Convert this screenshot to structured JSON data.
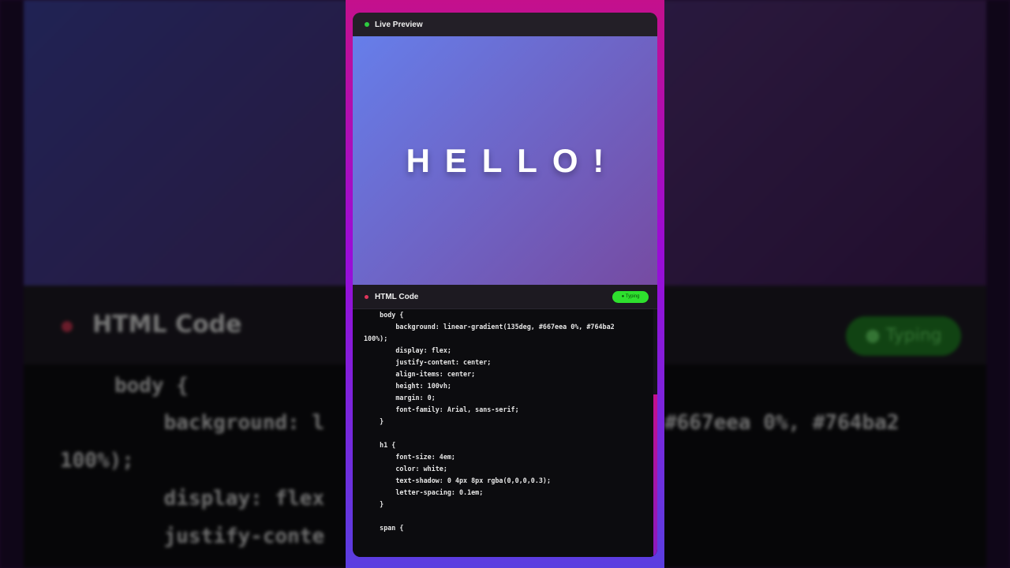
{
  "preview": {
    "title": "Live Preview",
    "heading": "HELLO!"
  },
  "code_panel": {
    "title": "HTML Code",
    "status": "● Typing",
    "lines": [
      "    body {",
      "        background: linear-gradient(135deg, #667eea 0%, #764ba2",
      "100%);",
      "        display: flex;",
      "        justify-content: center;",
      "        align-items: center;",
      "        height: 100vh;",
      "        margin: 0;",
      "        font-family: Arial, sans-serif;",
      "    }",
      "",
      "    h1 {",
      "        font-size: 4em;",
      "        color: white;",
      "        text-shadow: 0 4px 8px rgba(0,0,0,0.3);",
      "        letter-spacing: 0.1em;",
      "    }",
      "",
      "    span {"
    ]
  },
  "background_echo": {
    "title": "HTML Code",
    "status": "● Typing",
    "lines": [
      "body {",
      "    background: l",
      "#667eea 0%, #764ba2",
      "100%);",
      "    display: flex",
      "    justify-conte"
    ]
  },
  "colors": {
    "gradient_start": "#667eea",
    "gradient_end": "#764ba2",
    "typing_badge": "#2ee02e",
    "live_dot": "#2ecc40",
    "code_dot": "#e0355b"
  }
}
